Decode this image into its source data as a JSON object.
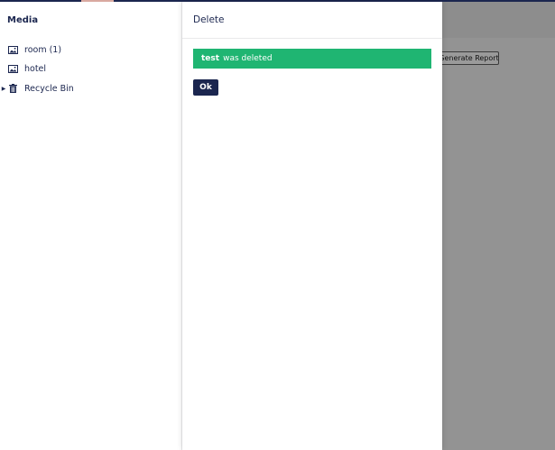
{
  "tree": {
    "title": "Media",
    "items": [
      {
        "label": "room (1)",
        "icon": "image-icon",
        "has_caret": false
      },
      {
        "label": "hotel",
        "icon": "image-icon",
        "has_caret": false
      },
      {
        "label": "Recycle Bin",
        "icon": "trash-icon",
        "has_caret": true
      }
    ]
  },
  "background": {
    "button_label": "Generate Report"
  },
  "panel": {
    "title": "Delete",
    "alert": {
      "item_name": "test",
      "message": "was deleted"
    },
    "ok_label": "Ok"
  },
  "colors": {
    "brand_dark": "#1b264f",
    "success": "#1fb572",
    "overlay": "#939393"
  }
}
